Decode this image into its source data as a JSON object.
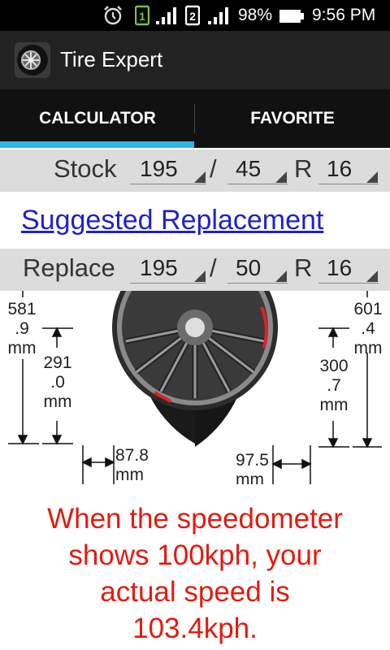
{
  "status_bar": {
    "sim1": "1",
    "sim2": "2",
    "battery": "98%",
    "time": "9:56 PM"
  },
  "action_bar": {
    "title": "Tire Expert",
    "icon": "tire-wheel-icon"
  },
  "tabs": [
    {
      "label": "CALCULATOR",
      "selected": true
    },
    {
      "label": "FAVORITE",
      "selected": false
    }
  ],
  "stock": {
    "label": "Stock",
    "width": "195",
    "sep1": "/",
    "ratio": "45",
    "sep2": "R",
    "rim": "16"
  },
  "suggest_link": "Suggested Replacement",
  "replace": {
    "label": "Replace",
    "width": "195",
    "sep1": "/",
    "ratio": "50",
    "sep2": "R",
    "rim": "16"
  },
  "diagram": {
    "stock_diameter": [
      "581",
      ".9",
      "mm"
    ],
    "stock_sidewall": [
      "291",
      ".0",
      "mm"
    ],
    "replace_diameter": [
      "601",
      ".4",
      "mm"
    ],
    "replace_sidewall": [
      "300",
      ".7",
      "mm"
    ],
    "stock_width": [
      "87.8",
      "mm"
    ],
    "replace_width": [
      "97.5",
      "mm"
    ]
  },
  "message": {
    "line1": "When the speedometer",
    "line2": "shows 100kph, your",
    "line3": "actual speed is",
    "line4": "103.4kph."
  },
  "colors": {
    "accent": "#33b5e5",
    "message": "#e31b0f",
    "link": "#1e22c8"
  }
}
